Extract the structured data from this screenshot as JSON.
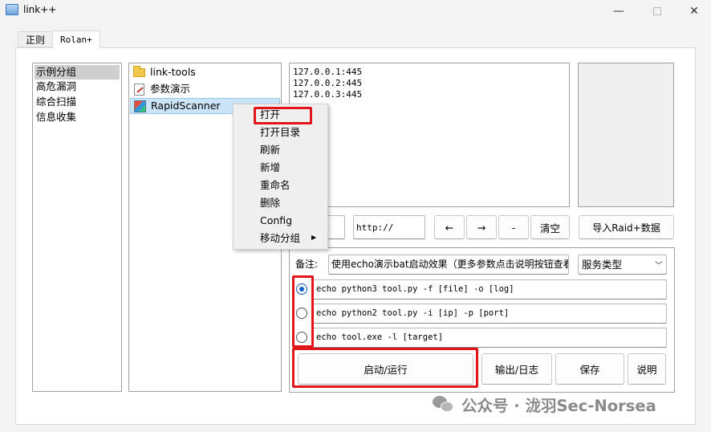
{
  "window": {
    "title": "link++"
  },
  "tabs": [
    {
      "label": "正则"
    },
    {
      "label": "Rolan+"
    }
  ],
  "groups": [
    "示例分组",
    "高危漏洞",
    "综合扫描",
    "信息收集"
  ],
  "tools": [
    {
      "label": "link-tools",
      "icon": "folder-icon"
    },
    {
      "label": "参数演示",
      "icon": "document-icon"
    },
    {
      "label": "RapidScanner",
      "icon": "executable-icon"
    }
  ],
  "targets": [
    "127.0.0.1:445",
    "127.0.0.2:445",
    "127.0.0.3:445"
  ],
  "toolbar": {
    "url_value": "http://",
    "left_arrow": "←",
    "right_arrow": "→",
    "minus": "-",
    "clear": "清空",
    "import": "导入Raid+数据"
  },
  "form": {
    "note_label": "备注:",
    "note_value": "使用echo演示bat启动效果（更多参数点击说明按钮查看）",
    "service_type": "服务类型"
  },
  "commands": [
    {
      "text": "echo python3 tool.py -f [file] -o [log]",
      "selected": true
    },
    {
      "text": "echo python2 tool.py -i [ip] -p [port]",
      "selected": false
    },
    {
      "text": "echo tool.exe -l [target]",
      "selected": false
    }
  ],
  "actions": {
    "run": "启动/运行",
    "output": "输出/日志",
    "save": "保存",
    "help": "说明"
  },
  "context_menu": [
    "打开",
    "打开目录",
    "刷新",
    "新增",
    "重命名",
    "删除",
    "Config",
    "移动分组"
  ],
  "watermark": "公众号 · 泷羽Sec-Norsea",
  "colors": {
    "highlight": "#e0161b",
    "selection": "#cce4f7",
    "radio_accent": "#0a63c9"
  }
}
